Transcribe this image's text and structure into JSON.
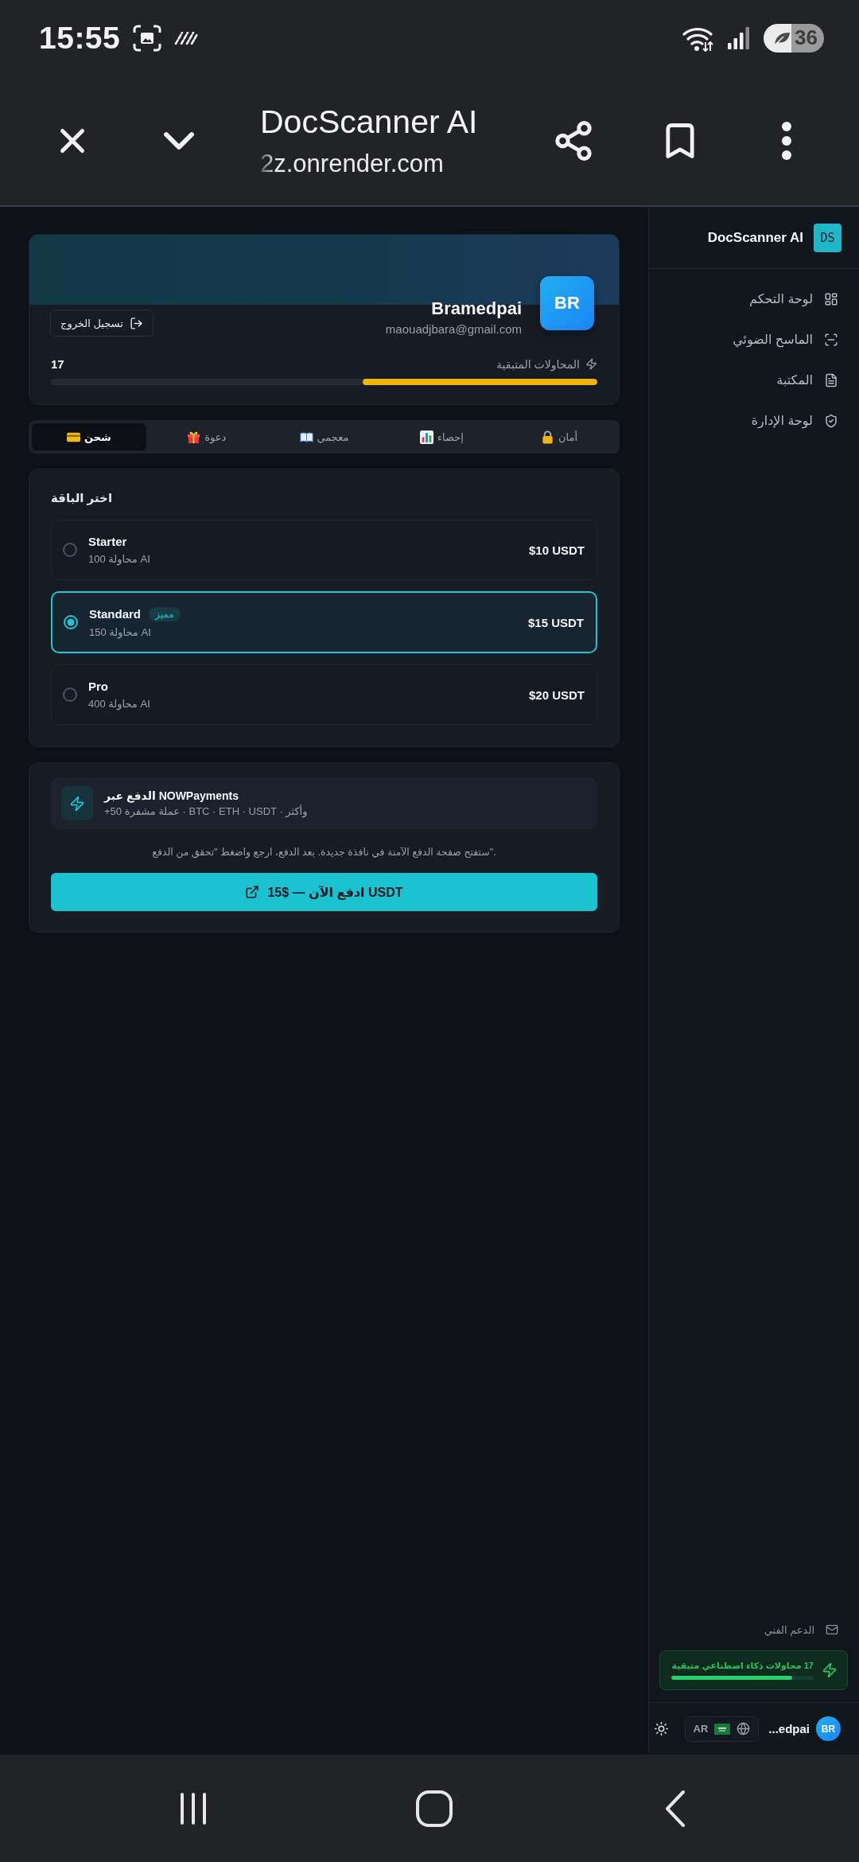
{
  "status_bar": {
    "time": "15:55",
    "battery": "36"
  },
  "browser_bar": {
    "title": "DocScanner AI",
    "url": "2z.onrender.com"
  },
  "profile": {
    "avatar": "BR",
    "name": "Bramedpai",
    "email": "maouadjbara@gmail.com",
    "logout": "تسجيل الخروج",
    "remaining_label": "المحاولات المتبقية",
    "remaining_count": "17",
    "level": 0.43
  },
  "tabs": [
    {
      "label": "أمان",
      "selected": false
    },
    {
      "label": "إحصاء",
      "selected": false
    },
    {
      "label": "معجمي",
      "selected": false
    },
    {
      "label": "دعوة",
      "selected": false
    },
    {
      "label": "شحن",
      "selected": true
    }
  ],
  "packages": {
    "heading": "اختر الباقة",
    "options": [
      {
        "name": "Starter",
        "subtitle": "100 محاولة AI",
        "price": "$10 USDT",
        "selected": false
      },
      {
        "name": "Standard",
        "badge": "مميز",
        "subtitle": "150 محاولة AI",
        "price": "$15 USDT",
        "selected": true
      },
      {
        "name": "Pro",
        "subtitle": "400 محاولة AI",
        "price": "$20 USDT",
        "selected": false
      }
    ]
  },
  "payment": {
    "title": "الدفع عبر NOWPayments",
    "subtitle": "+50 عملة مشفرة · BTC · ETH · USDT · وأكثر",
    "note": "ستفتح صفحة الدفع الآمنة في نافذة جديدة. بعد الدفع، ارجع واضغط \"تحقق من الدفع\".",
    "button": "ادفع الآن — $15 USDT"
  },
  "sidebar": {
    "brand": "DocScanner AI",
    "logo": "DS",
    "items": [
      {
        "label": "لوحة التحكم"
      },
      {
        "label": "الماسح الضوئي"
      },
      {
        "label": "المكتبة"
      },
      {
        "label": "لوحة الإدارة"
      }
    ],
    "support": "الدعم الفني",
    "credits": {
      "text": "17 محاولات ذكاء اصطناعي متبقية",
      "level": 0.85
    },
    "user": {
      "avatar": "BR",
      "name": "...edpai"
    },
    "language": "AR"
  }
}
